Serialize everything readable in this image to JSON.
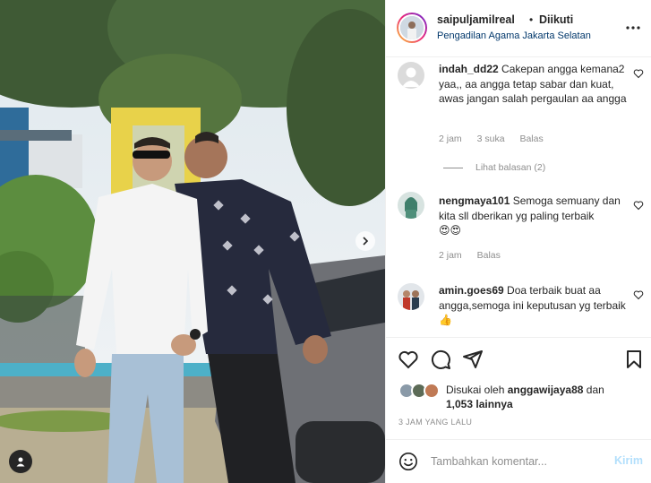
{
  "post": {
    "username": "saipuljamilreal",
    "dot": "•",
    "follow_status": "Diikuti",
    "location": "Pengadilan Agama Jakarta Selatan"
  },
  "comments": [
    {
      "username": "indah_dd22",
      "text": "Cakepan angga kemana2 yaa,, aa angga tetap sabar dan kuat, awas jangan salah pergaulan aa angga",
      "time": "2 jam",
      "likes": "3 suka",
      "reply": "Balas",
      "view_replies": "Lihat balasan (2)"
    },
    {
      "username": "nengmaya101",
      "text": "Semoga semuany dan kita sll dberikan yg paling terbaik",
      "emoji": "😍😍",
      "time": "2 jam",
      "reply": "Balas"
    },
    {
      "username": "amin.goes69",
      "text": "Doa terbaik buat aa angga,semoga ini keputusan yg terbaik👍"
    }
  ],
  "likes": {
    "prefix": "Disukai oleh",
    "user": "anggawijaya88",
    "connector": "dan",
    "others": "1,053 lainnya"
  },
  "time_ago": "3 JAM YANG LALU",
  "add_comment": {
    "placeholder": "Tambahkan komentar...",
    "post_label": "Kirim"
  },
  "icons": {
    "like": "heart-icon",
    "comment": "comment-icon",
    "share": "send-icon",
    "save": "bookmark-icon",
    "more": "more-options-icon",
    "emoji": "emoji-icon",
    "tagged": "user-tag-icon",
    "next": "chevron-right-icon"
  },
  "colors": {
    "link_blue": "#00376b",
    "post_button_disabled": "#b2dffc",
    "muted_text": "#8e8e8e"
  }
}
